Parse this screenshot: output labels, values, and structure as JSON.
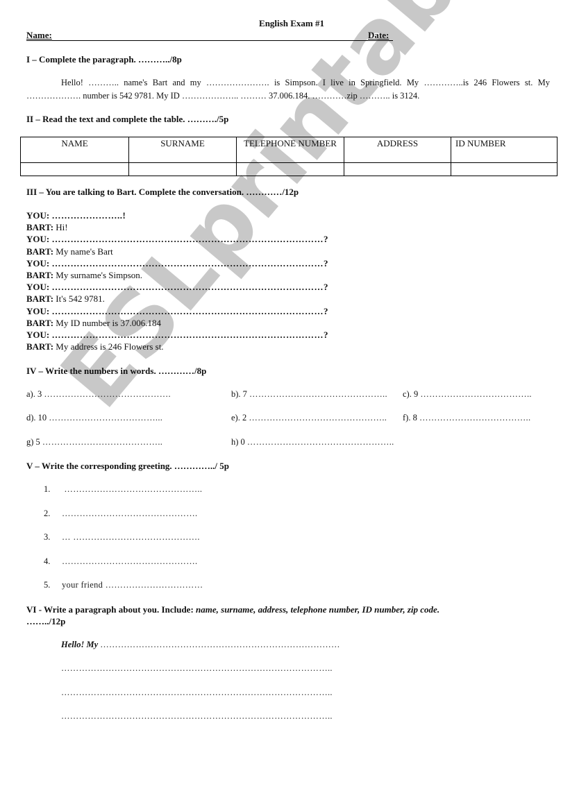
{
  "watermark": "ESLprintables.com",
  "header": {
    "title": "English Exam #1",
    "name_label": "Name:",
    "date_label": "Date:"
  },
  "section1": {
    "heading": "I – Complete the paragraph. ………../8p",
    "paragraph": "Hello! ……….. name's Bart and my …………………. is Simpson. I live in Springfield. My …………..is 246 Flowers st. My ………………. number is 542 9781. My ID ………………..   ……… 37.006.184. …………zip ……….. is 3124."
  },
  "section2": {
    "heading": "II – Read the text and complete the table. ………./5p",
    "columns": [
      "NAME",
      "SURNAME",
      "TELEPHONE NUMBER",
      "ADDRESS",
      "ID NUMBER"
    ],
    "rows": [
      [
        "",
        "",
        "",
        "",
        ""
      ]
    ]
  },
  "section3": {
    "heading": "III – You are talking to Bart. Complete the conversation. …………/12p",
    "lines": [
      {
        "speaker": "YOU:",
        "text": "…………………..!"
      },
      {
        "speaker": "BART:",
        "text": "Hi!"
      },
      {
        "speaker": "YOU:",
        "text": "……………………………………………………………………………?"
      },
      {
        "speaker": "BART:",
        "text": "My name's Bart"
      },
      {
        "speaker": "YOU:",
        "text": "……………………………………………………………………………?"
      },
      {
        "speaker": "BART:",
        "text": "My surname's Simpson."
      },
      {
        "speaker": "YOU:",
        "text": "……………………………………………………………………………?"
      },
      {
        "speaker": "BART:",
        "text": "It's 542 9781."
      },
      {
        "speaker": "YOU:",
        "text": "……………………………………………………………………………?"
      },
      {
        "speaker": "BART:",
        "text": "My ID number is 37.006.184"
      },
      {
        "speaker": "YOU:",
        "text": "……………………………………………………………………………?"
      },
      {
        "speaker": "BART:",
        "text": "My address is 246 Flowers st."
      }
    ]
  },
  "section4": {
    "heading": "IV –  Write the numbers in words. …………/8p",
    "items": [
      {
        "label": "a). 3",
        "dots": "……………………………………."
      },
      {
        "label": "b). 7",
        "dots": "……………………………………….."
      },
      {
        "label": "c). 9",
        "dots": "……………………………….."
      },
      {
        "label": "d). 10",
        "dots": "………………………………..."
      },
      {
        "label": "e). 2",
        "dots": "……………………………………….."
      },
      {
        "label": "f). 8",
        "dots": "……………………………….."
      },
      {
        "label": "g) 5",
        "dots": "………………………………….."
      },
      {
        "label": "h) 0",
        "dots": "………………………………………….."
      }
    ]
  },
  "section5": {
    "heading": "V – Write the corresponding greeting. …………../ 5p",
    "items": [
      {
        "num": "1.",
        "text": " ……………………………………….."
      },
      {
        "num": "2.",
        "text": "………………………………………."
      },
      {
        "num": "3.",
        "text": "… ……………………………………."
      },
      {
        "num": "4.",
        "text": "………………………………………."
      },
      {
        "num": "5.",
        "text": "your friend ……………………………"
      }
    ]
  },
  "section6": {
    "heading_plain": "VI - Write a paragraph about you. Include: ",
    "heading_italic": "name, surname, address, telephone number, ID number, zip code.",
    "score": "……../12p",
    "lines": [
      {
        "lead": "Hello! My",
        "dots": "………………………………………………………………………"
      },
      {
        "lead": "",
        "dots": "……………………………………………………………………………….."
      },
      {
        "lead": "",
        "dots": "……………………………………………………………………………….."
      },
      {
        "lead": "",
        "dots": "……………………………………………………………………………….."
      }
    ]
  }
}
